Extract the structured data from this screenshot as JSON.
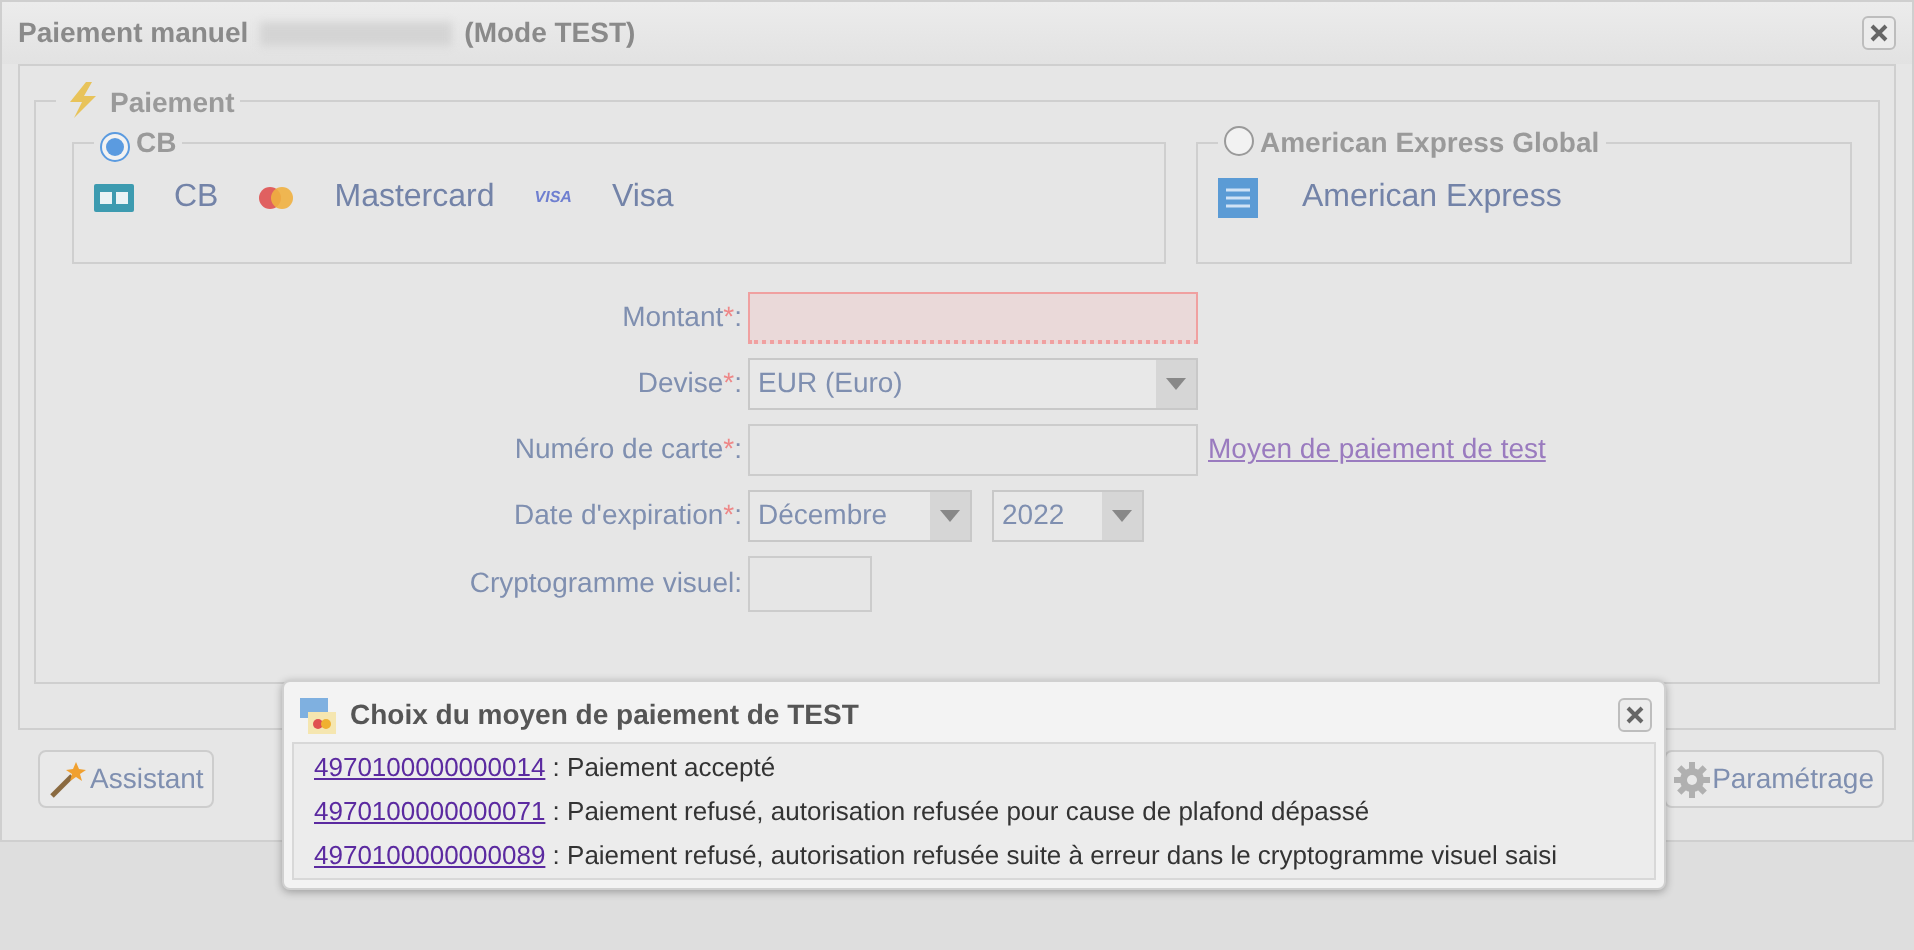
{
  "dialog": {
    "title": "Paiement manuel",
    "title_redacted": true,
    "title_suffix": "(Mode TEST)"
  },
  "section": {
    "legend": "Paiement"
  },
  "methods": [
    {
      "label": "CB",
      "selected": true,
      "brands": [
        {
          "kind": "cb",
          "name": "CB"
        },
        {
          "kind": "mastercard",
          "name": "Mastercard"
        },
        {
          "kind": "visa",
          "name": "Visa",
          "logo_text": "VISA"
        }
      ]
    },
    {
      "label": "American Express Global",
      "selected": false,
      "brands": [
        {
          "kind": "amex",
          "name": "American Express"
        }
      ]
    }
  ],
  "fields": [
    {
      "kind": "text",
      "label": "Montant",
      "required_mark": "*",
      "label_end": ":",
      "invalid": true
    },
    {
      "kind": "select",
      "label": "Devise",
      "required_mark": "*",
      "label_end": ":",
      "value": "EUR (Euro)"
    },
    {
      "kind": "text",
      "label": "Numéro de carte",
      "required_mark": "*",
      "label_end": ":",
      "invalid": false,
      "link": "Moyen de paiement de test"
    },
    {
      "kind": "date",
      "label": "Date d'expiration",
      "required_mark": "*",
      "label_end": ":",
      "values": [
        "Décembre",
        "2022"
      ]
    },
    {
      "kind": "short",
      "label": "Cryptogramme visuel:"
    }
  ],
  "buttons": [
    {
      "kind": "wand",
      "label": "Assistant"
    },
    {
      "kind": "gear",
      "label": "Paramétrage"
    }
  ],
  "popup": {
    "title": "Choix du moyen de paiement de TEST",
    "cards": [
      {
        "number": "4970100000000014",
        "description": " : Paiement accepté"
      },
      {
        "number": "4970100000000071",
        "description": " : Paiement refusé, autorisation refusée pour cause de plafond dépassé"
      },
      {
        "number": "4970100000000089",
        "description": " : Paiement refusé, autorisation refusée suite à erreur dans le cryptogramme visuel saisi"
      }
    ]
  }
}
